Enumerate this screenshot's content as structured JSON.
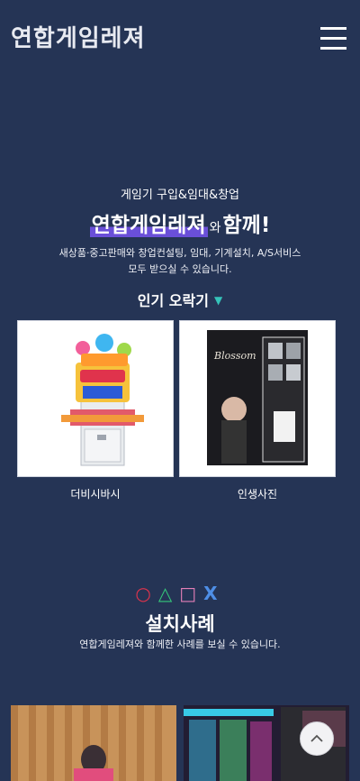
{
  "header": {
    "logo_text": "연합게임레져",
    "menu_icon": "hamburger-menu-icon"
  },
  "intro": {
    "sub": "게임기 구입&임대&창업",
    "brand": "연합게임레져",
    "with_small": "와",
    "together": "함께!",
    "desc_line1": "새상품·중고판매와 창업컨설팅, 임대, 기계설치, A/S서비스",
    "desc_line2": "모두 받으실 수 있습니다."
  },
  "popular": {
    "title": "인기 오락기",
    "arrow_icon": "triangle-down-icon"
  },
  "products": [
    {
      "name": "더비시바시"
    },
    {
      "name": "인생사진",
      "sign": "Blossom"
    }
  ],
  "cases": {
    "symbols": [
      "○",
      "△",
      "□",
      "X"
    ],
    "title": "설치사례",
    "desc": "연합게임레져와 함께한 사례를 보실 수 있습니다."
  },
  "scroll_top_icon": "chevron-up-icon",
  "colors": {
    "background": "#253455",
    "highlight": "#6a4fd8",
    "accent_triangle": "#35c3b9"
  }
}
